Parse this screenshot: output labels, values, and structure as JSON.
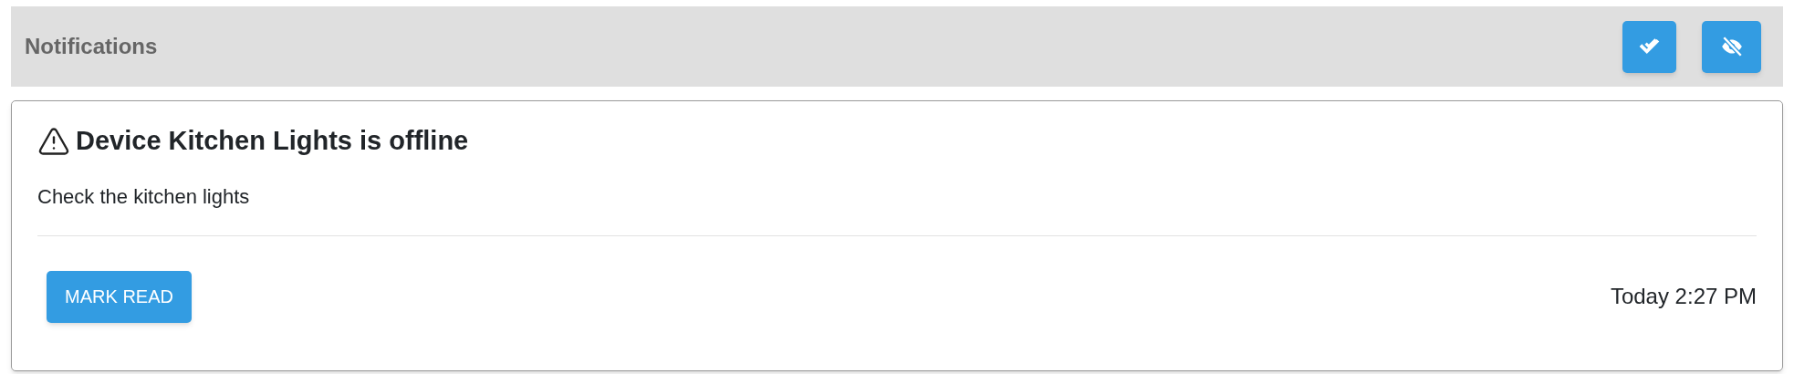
{
  "header": {
    "title": "Notifications"
  },
  "notifications": [
    {
      "title": "Device Kitchen Lights is offline",
      "message": "Check the kitchen lights",
      "action": "MARK READ",
      "time": "Today 2:27 PM",
      "kind": "warning"
    }
  ]
}
